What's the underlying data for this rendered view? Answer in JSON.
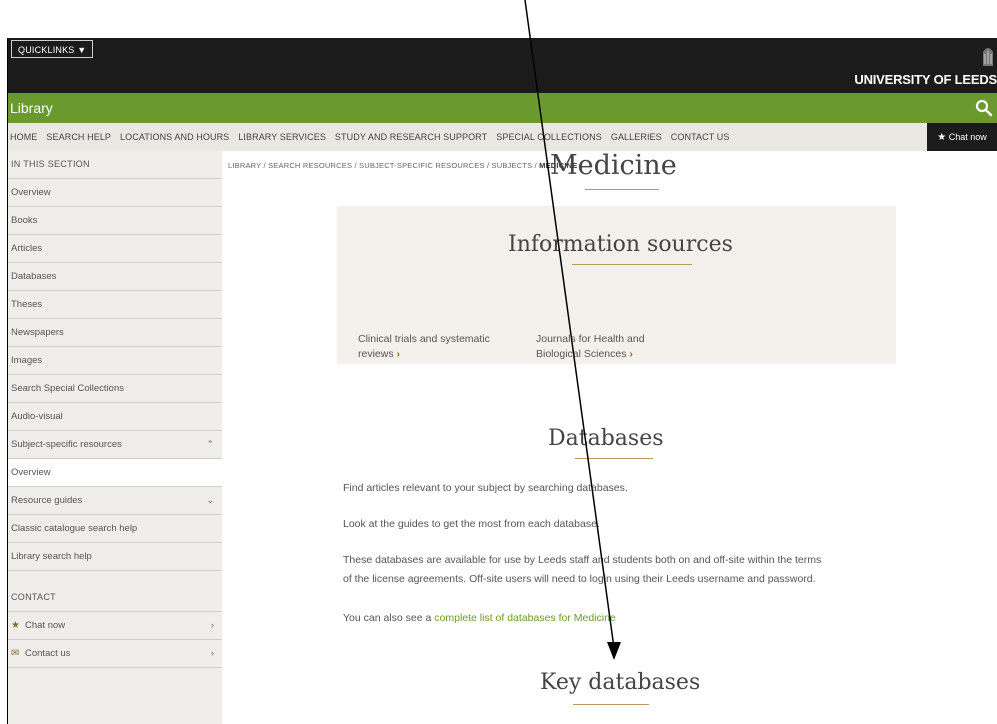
{
  "header": {
    "quicklinks_label": "QUICKLINKS ▼",
    "university": "UNIVERSITY OF LEEDS"
  },
  "library_bar": {
    "title": "Library",
    "search_icon": "search-icon"
  },
  "nav": {
    "items": [
      "HOME",
      "SEARCH HELP",
      "LOCATIONS AND HOURS",
      "LIBRARY SERVICES",
      "STUDY AND RESEARCH SUPPORT",
      "SPECIAL COLLECTIONS",
      "GALLERIES",
      "CONTACT US"
    ],
    "chat_label": "Chat now"
  },
  "sidebar": {
    "heading": "IN THIS SECTION",
    "items": [
      "Overview",
      "Books",
      "Articles",
      "Databases",
      "Theses",
      "Newspapers",
      "Images",
      "Search Special Collections",
      "Audio-visual",
      "Subject-specific resources",
      "Overview",
      "Resource guides",
      "Classic catalogue search help",
      "Library search help"
    ],
    "contact_heading": "CONTACT",
    "contact_items": [
      "Chat now",
      "Contact us"
    ]
  },
  "breadcrumb": {
    "parts": [
      "LIBRARY",
      "SEARCH RESOURCES",
      "SUBJECT-SPECIFIC RESOURCES",
      "SUBJECTS"
    ],
    "separator": " / ",
    "current": "MEDICINE"
  },
  "main": {
    "title": "Medicine",
    "info_heading": "Information sources",
    "info_links": [
      {
        "line1": "Clinical trials and systematic",
        "line2": "reviews"
      },
      {
        "line1": "Journals for Health and",
        "line2": "Biological Sciences"
      }
    ],
    "databases_heading": "Databases",
    "para1": "Find articles relevant to your subject by searching databases.",
    "para2": "Look at the guides to get the most from each database.",
    "para3_line1": "These databases are available for use by Leeds staff and students both on and off-site within the terms",
    "para3_line2": "of the license agreements. Off-site users will need to login using their Leeds username and password.",
    "para4_prefix": "You can also see a ",
    "para4_link": "complete list of databases for Medicine",
    "key_heading": "Key databases"
  },
  "colors": {
    "green": "#6a9a2e",
    "dark": "#1b1b1b",
    "gold": "#b49a63"
  }
}
